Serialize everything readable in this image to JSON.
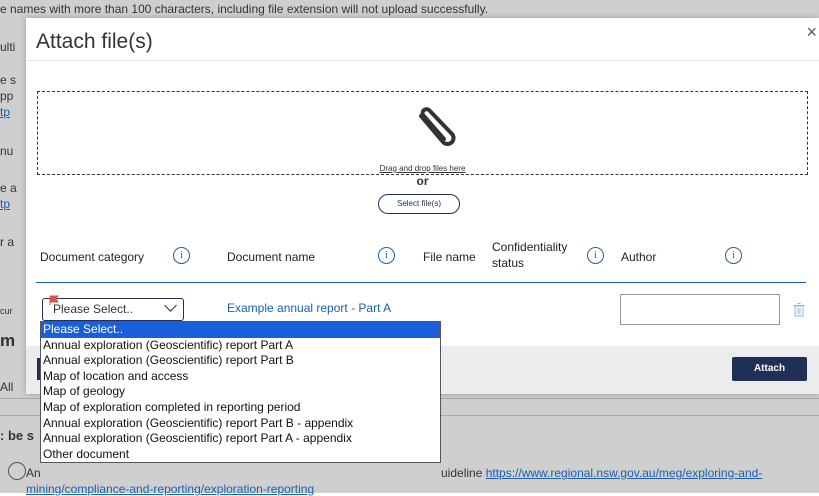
{
  "background": {
    "top_text": "e names with more than 100 characters, including file extension will not upload successfully.",
    "left_fragments": [
      "ulti",
      "e s",
      "pp",
      "tp",
      "nu",
      "e a",
      "tp",
      "r a",
      "cur",
      "m",
      "All",
      ": be s",
      "An"
    ],
    "bottom_text": "uideline ",
    "bottom_link": "https://www.regional.nsw.gov.au/meg/exploring-and-",
    "bottom_link2": "mining/compliance-and-reporting/exploration-reporting"
  },
  "modal": {
    "title": "Attach file(s)",
    "close": "×",
    "drop_hint": "Drag and drop files here",
    "or": "or",
    "select_button": "Select file(s)",
    "columns": {
      "category": "Document category",
      "name": "Document name",
      "file": "File name",
      "confidentiality_1": "Confidentiality",
      "confidentiality_2": "status",
      "author": "Author"
    },
    "info_glyph": "i",
    "row": {
      "category_value": "Please Select..",
      "document_name": "Example annual report - Part A",
      "author_value": ""
    },
    "attach_button": "Attach"
  },
  "dropdown": {
    "options": [
      "Please Select..",
      "Annual exploration (Geoscientific) report Part A",
      "Annual exploration (Geoscientific) report Part B",
      "Map of location and access",
      "Map of geology",
      "Map of exploration completed in reporting period",
      "Annual exploration (Geoscientific) report Part B - appendix",
      "Annual exploration (Geoscientific) report Part A - appendix",
      "Other document"
    ],
    "selected_index": 0
  },
  "colors": {
    "accent": "#1a5fb4",
    "navy": "#1f2f55",
    "selection": "#1a5fd9",
    "required_flag": "#d9534f"
  }
}
